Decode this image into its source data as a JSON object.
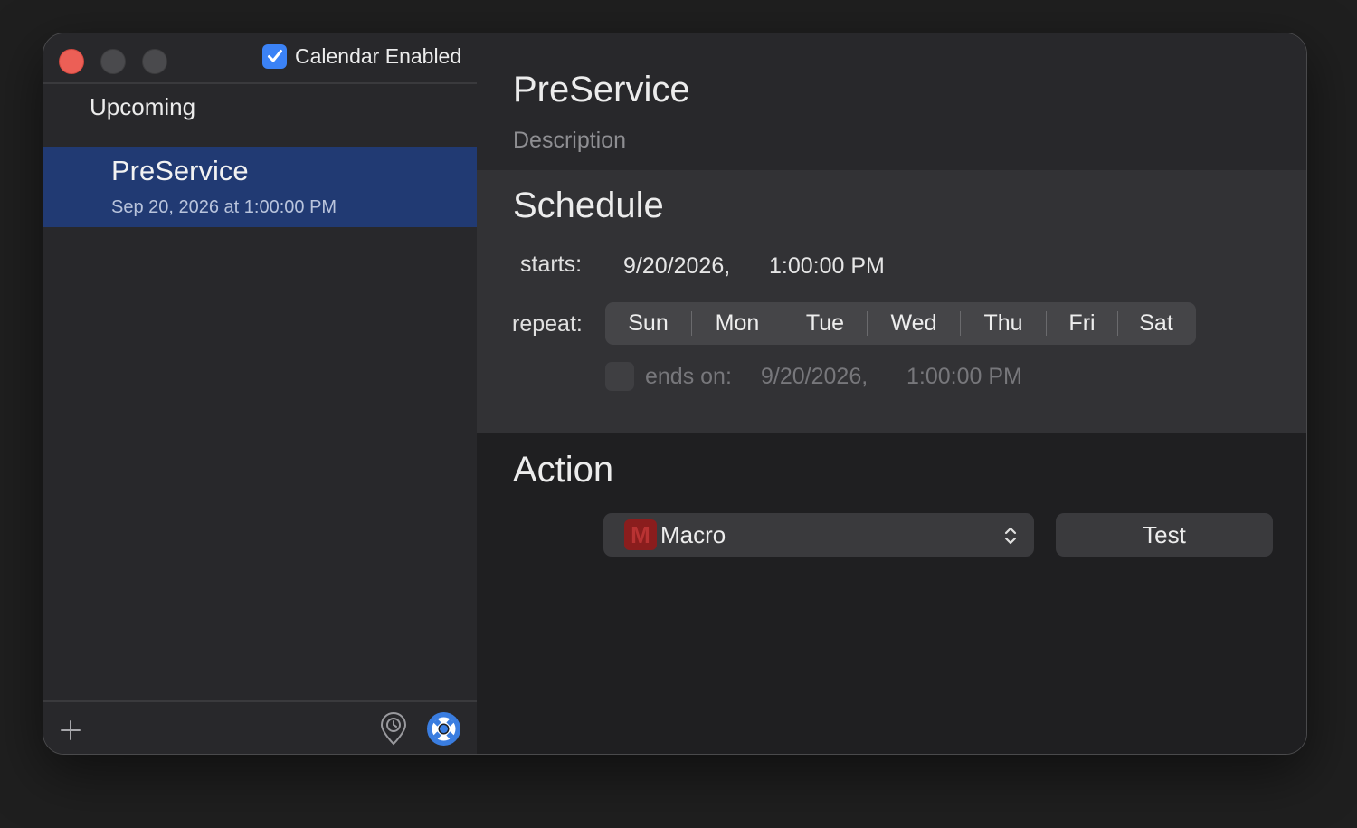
{
  "sidebar": {
    "calendar_enabled_label": "Calendar Enabled",
    "calendar_enabled": true,
    "section_title": "Upcoming",
    "events": [
      {
        "title": "PreService",
        "date": "Sep 20, 2026 at 1:00:00 PM",
        "selected": true
      }
    ],
    "footer": {
      "add_icon": "plus-icon",
      "location_icon": "location-pin-icon",
      "help_icon": "lifebuoy-icon"
    }
  },
  "detail": {
    "title": "PreService",
    "description_placeholder": "Description",
    "schedule": {
      "title": "Schedule",
      "starts_label": "starts:",
      "starts_date": "9/20/2026,",
      "starts_time": "1:00:00 PM",
      "repeat_label": "repeat:",
      "days": [
        "Sun",
        "Mon",
        "Tue",
        "Wed",
        "Thu",
        "Fri",
        "Sat"
      ],
      "ends_on_enabled": false,
      "ends_on_label": "ends on:",
      "ends_date": "9/20/2026,",
      "ends_time": "1:00:00 PM"
    },
    "action": {
      "title": "Action",
      "selected": "Macro",
      "macro_icon_letter": "M",
      "test_label": "Test"
    }
  },
  "colors": {
    "accent": "#3b82f6",
    "selection": "#213a73",
    "close": "#ec5f56"
  }
}
